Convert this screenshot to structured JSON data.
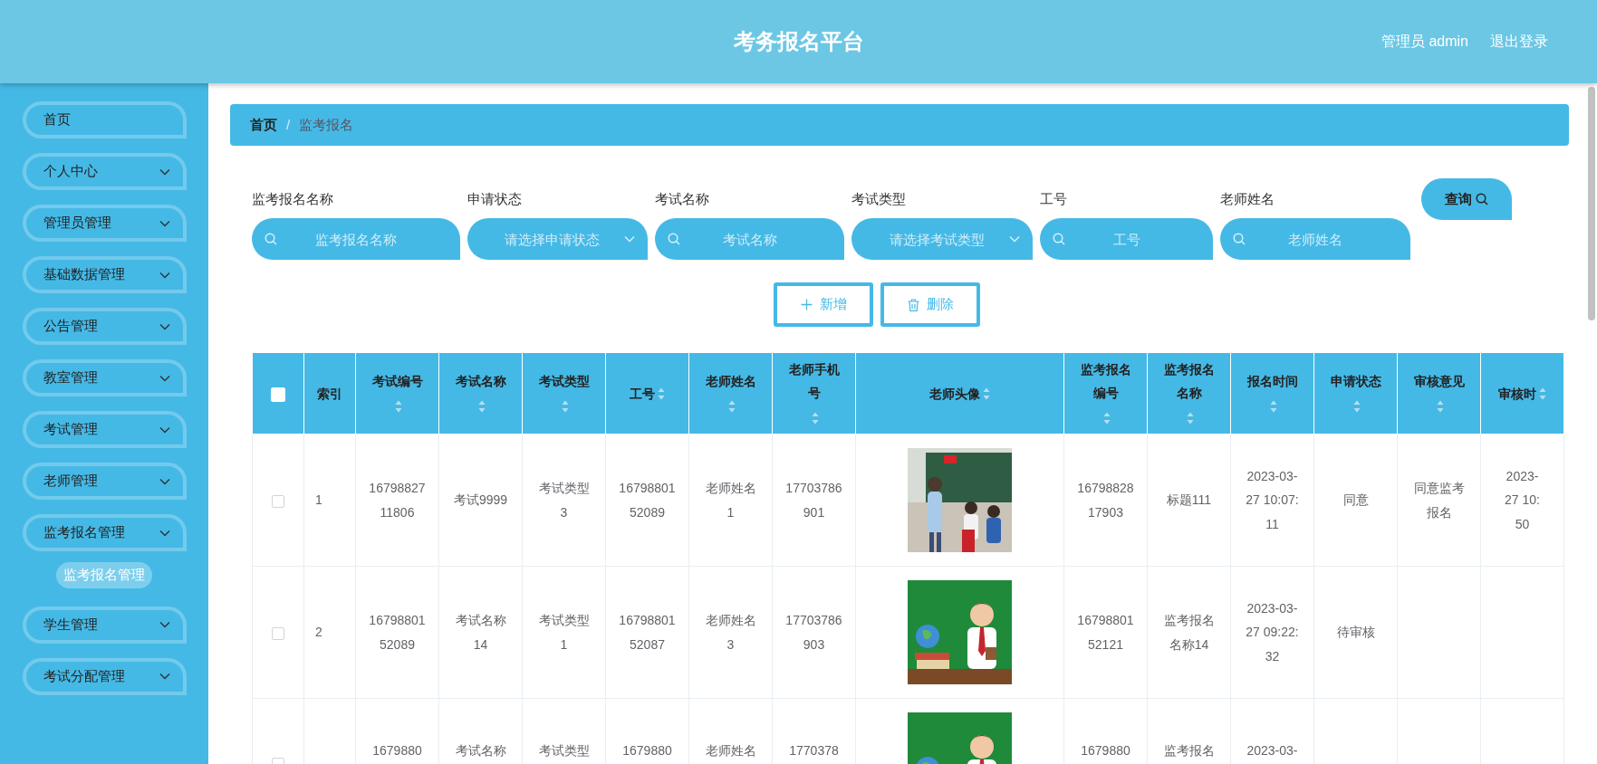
{
  "header": {
    "title": "考务报名平台",
    "user": "管理员 admin",
    "logout": "退出登录"
  },
  "sidebar": {
    "items": [
      {
        "label": "首页",
        "expandable": false,
        "selected": false
      },
      {
        "label": "个人中心",
        "expandable": true,
        "selected": false
      },
      {
        "label": "管理员管理",
        "expandable": true,
        "selected": false
      },
      {
        "label": "基础数据管理",
        "expandable": true,
        "selected": false
      },
      {
        "label": "公告管理",
        "expandable": true,
        "selected": false
      },
      {
        "label": "教室管理",
        "expandable": true,
        "selected": false
      },
      {
        "label": "考试管理",
        "expandable": true,
        "selected": false
      },
      {
        "label": "老师管理",
        "expandable": true,
        "selected": false
      },
      {
        "label": "监考报名管理",
        "expandable": true,
        "selected": false,
        "children": [
          {
            "label": "监考报名管理",
            "selected": true
          }
        ]
      },
      {
        "label": "学生管理",
        "expandable": true,
        "selected": false
      },
      {
        "label": "考试分配管理",
        "expandable": true,
        "selected": false
      }
    ]
  },
  "breadcrumb": {
    "separator": "/",
    "items": [
      {
        "label": "首页",
        "current": false
      },
      {
        "label": "监考报名",
        "current": true
      }
    ]
  },
  "filters": [
    {
      "label": "监考报名名称",
      "kind": "text",
      "placeholder": "监考报名名称"
    },
    {
      "label": "申请状态",
      "kind": "select",
      "placeholder": "请选择申请状态"
    },
    {
      "label": "考试名称",
      "kind": "text",
      "placeholder": "考试名称"
    },
    {
      "label": "考试类型",
      "kind": "select",
      "placeholder": "请选择考试类型"
    },
    {
      "label": "工号",
      "kind": "text",
      "placeholder": "工号"
    },
    {
      "label": "老师姓名",
      "kind": "text",
      "placeholder": "老师姓名"
    }
  ],
  "search_button": "查询",
  "actions": [
    {
      "label": "新增",
      "kind": "add"
    },
    {
      "label": "删除",
      "kind": "delete"
    }
  ],
  "table": {
    "select_all_checked": false,
    "columns": [
      {
        "label": "索引",
        "sortable": false
      },
      {
        "label": "考试编号",
        "sortable": true
      },
      {
        "label": "考试名称",
        "sortable": true
      },
      {
        "label": "考试类型",
        "sortable": true
      },
      {
        "label": "工号",
        "sortable": true
      },
      {
        "label": "老师姓名",
        "sortable": true
      },
      {
        "label": "老师手机号",
        "sortable": true
      },
      {
        "label": "老师头像",
        "sortable": true
      },
      {
        "label": "监考报名编号",
        "sortable": true
      },
      {
        "label": "监考报名名称",
        "sortable": true
      },
      {
        "label": "报名时间",
        "sortable": true
      },
      {
        "label": "申请状态",
        "sortable": true
      },
      {
        "label": "审核意见",
        "sortable": true
      },
      {
        "label": "审核时",
        "sortable": true
      }
    ],
    "rows": [
      {
        "checked": false,
        "index": "1",
        "exam_no": "1679882711806",
        "exam_name": "考试9999",
        "exam_type": "考试类型3",
        "staff_no": "1679880152089",
        "teacher_name": "老师姓名1",
        "teacher_phone": "17703786901",
        "reg_no": "1679882817903",
        "reg_name": "标题111",
        "reg_time": "2023-03-27 10:07:11",
        "status": "同意",
        "review_opinion": "同意监考报名",
        "review_time": "2023-\n27 10:\n50"
      },
      {
        "checked": false,
        "index": "2",
        "exam_no": "1679880152089",
        "exam_name": "考试名称14",
        "exam_type": "考试类型1",
        "staff_no": "1679880152087",
        "teacher_name": "老师姓名3",
        "teacher_phone": "17703786903",
        "reg_no": "1679880152121",
        "reg_name": "监考报名名称14",
        "reg_time": "2023-03-27 09:22:32",
        "status": "待审核"
      },
      {
        "checked": false,
        "exam_no": "1679880",
        "exam_name": "考试名称",
        "exam_type": "考试类型",
        "staff_no": "1679880",
        "teacher_name": "老师姓名",
        "teacher_phone": "1770378",
        "reg_no": "1679880",
        "reg_name": "监考报名",
        "reg_time": "2023-03-"
      }
    ]
  }
}
